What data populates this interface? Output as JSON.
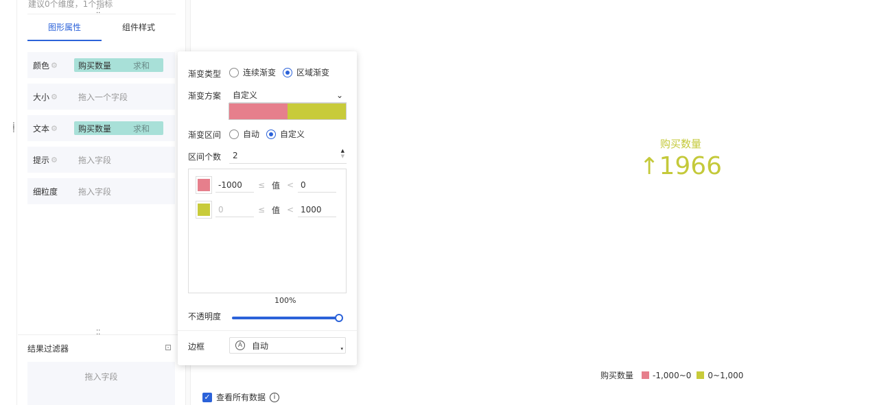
{
  "panel": {
    "hint": "建议0个维度，1个指标",
    "tabs": [
      {
        "label": "图形属性",
        "active": true
      },
      {
        "label": "组件样式",
        "active": false
      }
    ],
    "fields": [
      {
        "label": "颜色",
        "value": "购买数量",
        "agg": "求和",
        "filled": true
      },
      {
        "label": "大小",
        "placeholder": "拖入一个字段",
        "filled": false
      },
      {
        "label": "文本",
        "value": "购买数量",
        "agg": "求和",
        "filled": true
      },
      {
        "label": "提示",
        "placeholder": "拖入字段",
        "filled": false
      },
      {
        "label": "细粒度",
        "placeholder": "拖入字段",
        "filled": false
      }
    ],
    "filter": {
      "title": "结果过滤器",
      "placeholder": "拖入字段"
    }
  },
  "popover": {
    "gradient_type": {
      "label": "渐变类型",
      "options": [
        "连续渐变",
        "区域渐变"
      ],
      "selected": "区域渐变"
    },
    "gradient_scheme": {
      "label": "渐变方案",
      "value": "自定义",
      "colors": [
        "#e67f8c",
        "#c8cb3a"
      ]
    },
    "gradient_range": {
      "label": "渐变区间",
      "options": [
        "自动",
        "自定义"
      ],
      "selected": "自定义"
    },
    "range_count": {
      "label": "区间个数",
      "value": "2"
    },
    "ranges": [
      {
        "color": "#e67f8c",
        "min": "-1000",
        "max": "0",
        "min_disabled": false
      },
      {
        "color": "#c8cb3a",
        "min": "0",
        "max": "1000",
        "min_disabled": true
      }
    ],
    "range_op": "≤",
    "range_op2": "<",
    "range_word": "值",
    "opacity": {
      "label": "不透明度",
      "value": "100%",
      "fraction": 1.0
    },
    "border": {
      "label": "边框",
      "value": "自动",
      "icon_letter": "A"
    }
  },
  "kpi": {
    "title": "购买数量",
    "arrow": "↑",
    "value": "1966",
    "color": "#c4c93a"
  },
  "legend": {
    "title": "购买数量",
    "items": [
      {
        "label": "-1,000~0",
        "color": "#e67f8c"
      },
      {
        "label": "0~1,000",
        "color": "#c8cb3a"
      }
    ]
  },
  "footer": {
    "checkbox_label": "查看所有数据",
    "checked": true
  }
}
